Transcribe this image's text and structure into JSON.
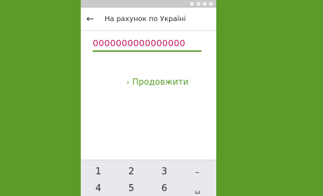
{
  "header": {
    "title": "На рахунок по Україні"
  },
  "account_field": {
    "value": "0000000000000000"
  },
  "continue_button": {
    "label": "Продовжити"
  },
  "keypad": {
    "row1": [
      "1",
      "2",
      "3",
      "–"
    ],
    "row2": [
      "4",
      "5",
      "6",
      "␣"
    ]
  },
  "colors": {
    "background": "#5b9c28",
    "accent": "#5a9d2d",
    "input_text": "#c2185b"
  },
  "icons": [
    "arrow-left-icon",
    "chevron-right-icon"
  ]
}
